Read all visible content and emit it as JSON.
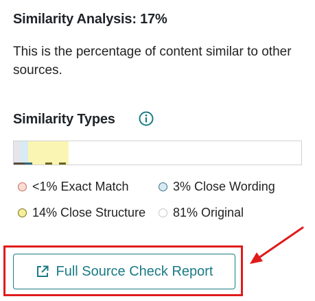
{
  "analysis": {
    "title": "Similarity Analysis: 17%",
    "description": "This is the percentage of content similar to other sources."
  },
  "types": {
    "title": "Similarity Types",
    "info_icon": "info-circle-icon",
    "bar": [
      {
        "key": "exact",
        "fraction": 0.02
      },
      {
        "key": "wording",
        "fraction": 0.03
      },
      {
        "key": "structure",
        "fraction": 0.14
      },
      {
        "key": "original",
        "fraction": 0.81
      }
    ],
    "legend": [
      {
        "key": "exact",
        "label": "<1% Exact Match",
        "fill": "#f9ddd5",
        "border": "#c96a5b"
      },
      {
        "key": "wording",
        "label": "3% Close Wording",
        "fill": "#d7eaf3",
        "border": "#3b6f86"
      },
      {
        "key": "structure",
        "label": "14% Close Structure",
        "fill": "#f5ee9a",
        "border": "#7c7420"
      },
      {
        "key": "original",
        "label": "81% Original",
        "fill": "#ffffff",
        "border": "#c7c7c7"
      }
    ]
  },
  "report_button": {
    "label": "Full Source Check Report",
    "icon": "external-link-icon"
  },
  "colors": {
    "accent": "#1a7a84",
    "highlight": "#e01b1b"
  }
}
